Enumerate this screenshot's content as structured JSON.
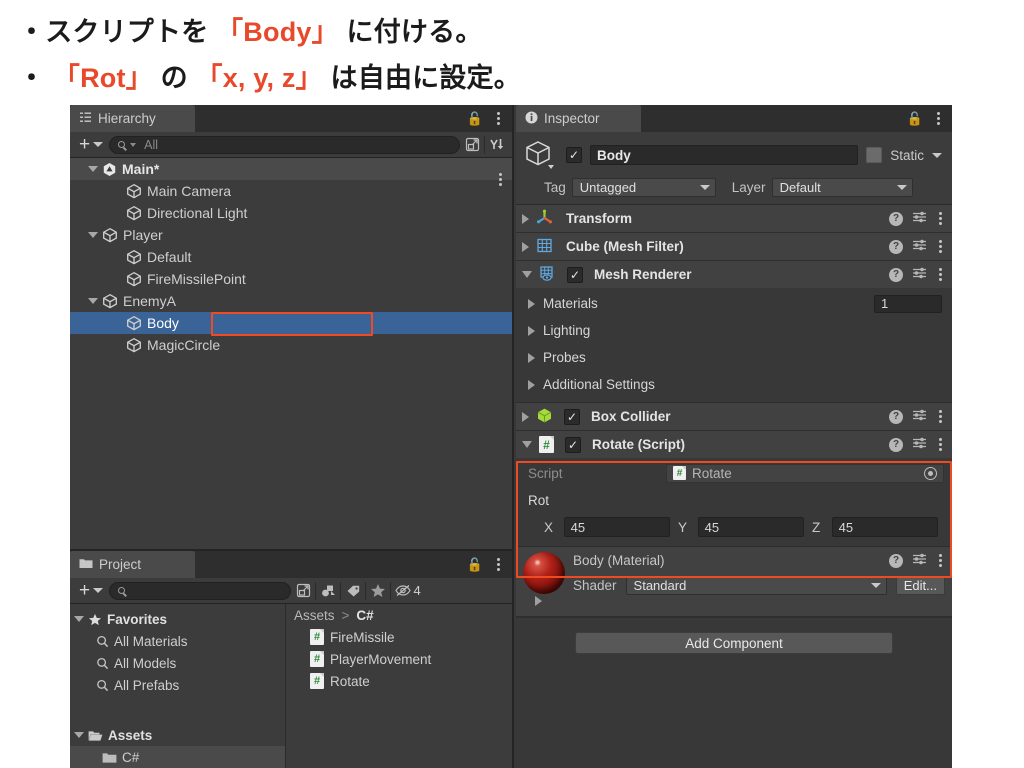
{
  "caption": {
    "line1_pre": "・スクリプトを ",
    "line1_hl": "「Body」",
    "line1_post": " に付ける。",
    "line2_pre": "・ ",
    "line2_hl1": "「Rot」",
    "line2_mid": " の ",
    "line2_hl2": "「x, y, z」",
    "line2_post": " は自由に設定。",
    "highlight_color": "#e8492b"
  },
  "hierarchy": {
    "tab_label": "Hierarchy",
    "search_placeholder": "All",
    "plus_label": "+",
    "items": [
      {
        "label": "Main*",
        "depth": 1,
        "expanded": true,
        "type": "scene",
        "selected": false
      },
      {
        "label": "Main Camera",
        "depth": 2,
        "expanded": null,
        "type": "gameobject",
        "selected": false
      },
      {
        "label": "Directional Light",
        "depth": 2,
        "expanded": null,
        "type": "gameobject",
        "selected": false
      },
      {
        "label": "Player",
        "depth": 1,
        "expanded": true,
        "type": "gameobject",
        "selected": false
      },
      {
        "label": "Default",
        "depth": 2,
        "expanded": null,
        "type": "gameobject",
        "selected": false
      },
      {
        "label": "FireMissilePoint",
        "depth": 2,
        "expanded": null,
        "type": "gameobject",
        "selected": false
      },
      {
        "label": "EnemyA",
        "depth": 1,
        "expanded": true,
        "type": "gameobject",
        "selected": false
      },
      {
        "label": "Body",
        "depth": 2,
        "expanded": null,
        "type": "gameobject",
        "selected": true
      },
      {
        "label": "MagicCircle",
        "depth": 2,
        "expanded": null,
        "type": "gameobject",
        "selected": false
      }
    ]
  },
  "project": {
    "tab_label": "Project",
    "search_placeholder": "",
    "hidden_count": "4",
    "tree": [
      {
        "label": "Favorites",
        "kind": "favorites-root",
        "bold": true,
        "selected": false
      },
      {
        "label": "All Materials",
        "kind": "search-favorite",
        "bold": false,
        "selected": false
      },
      {
        "label": "All Models",
        "kind": "search-favorite",
        "bold": false,
        "selected": false
      },
      {
        "label": "All Prefabs",
        "kind": "search-favorite",
        "bold": false,
        "selected": false
      },
      {
        "label": "Assets",
        "kind": "folder-root",
        "bold": true,
        "selected": false
      },
      {
        "label": "C#",
        "kind": "folder",
        "bold": false,
        "selected": true
      }
    ],
    "breadcrumb": {
      "root": "Assets",
      "separator": ">",
      "current": "C#"
    },
    "assets": [
      {
        "label": "FireMissile",
        "type": "cs-script"
      },
      {
        "label": "PlayerMovement",
        "type": "cs-script"
      },
      {
        "label": "Rotate",
        "type": "cs-script"
      }
    ]
  },
  "inspector": {
    "tab_label": "Inspector",
    "gameobject": {
      "enabled": true,
      "name": "Body",
      "static_label": "Static",
      "static_checked": false,
      "tag_label": "Tag",
      "tag_value": "Untagged",
      "layer_label": "Layer",
      "layer_value": "Default"
    },
    "components": [
      {
        "name": "Transform",
        "icon": "transform-icon",
        "expanded": false,
        "has_toggle": false
      },
      {
        "name": "Cube (Mesh Filter)",
        "icon": "mesh-filter-icon",
        "expanded": false,
        "has_toggle": false
      },
      {
        "name": "Mesh Renderer",
        "icon": "mesh-renderer-icon",
        "expanded": true,
        "has_toggle": true,
        "enabled": true
      }
    ],
    "mesh_renderer_sections": [
      {
        "label": "Materials",
        "value": "1"
      },
      {
        "label": "Lighting",
        "value": ""
      },
      {
        "label": "Probes",
        "value": ""
      },
      {
        "label": "Additional Settings",
        "value": ""
      }
    ],
    "box_collider": {
      "name": "Box Collider",
      "enabled": true,
      "expanded": false
    },
    "rotate_script": {
      "name": "Rotate (Script)",
      "enabled": true,
      "expanded": true,
      "script_label": "Script",
      "script_value": "Rotate",
      "rot_label": "Rot",
      "axes": [
        {
          "label": "X",
          "value": "45"
        },
        {
          "label": "Y",
          "value": "45"
        },
        {
          "label": "Z",
          "value": "45"
        }
      ]
    },
    "material": {
      "title": "Body (Material)",
      "shader_label": "Shader",
      "shader_value": "Standard",
      "edit_label": "Edit..."
    },
    "add_component_label": "Add Component"
  }
}
